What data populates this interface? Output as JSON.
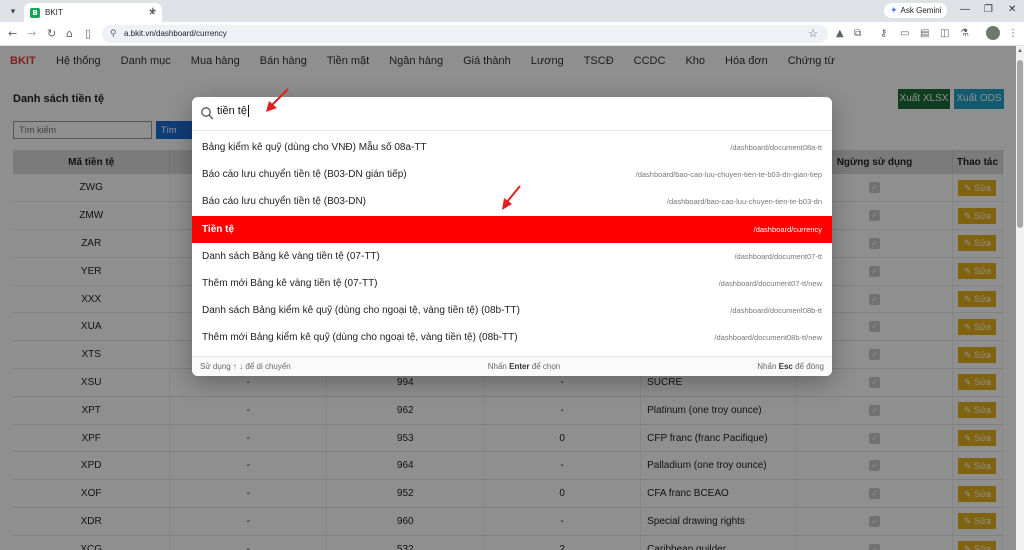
{
  "browser": {
    "tab_title": "BKIT",
    "favicon_letter": "B",
    "url": "a.bkit.vn/dashboard/currency",
    "ask_gemini": "Ask Gemini"
  },
  "app": {
    "brand": "BKIT",
    "nav": [
      "Hệ thống",
      "Danh mục",
      "Mua hàng",
      "Bán hàng",
      "Tiền mặt",
      "Ngân hàng",
      "Giá thành",
      "Lương",
      "TSCĐ",
      "CCDC",
      "Kho",
      "Hóa đơn",
      "Chứng từ"
    ],
    "page_title": "Danh sách tiền tệ",
    "export_xlsx": "Xuất XLSX",
    "export_ods": "Xuất ODS",
    "search_placeholder": "Tìm kiếm",
    "search_button": "Tìm",
    "columns": [
      "Mã tiền tệ",
      "",
      "",
      "",
      "",
      "Ngừng sử dụng",
      "Thao tác"
    ],
    "edit_label": "✎ Sửa",
    "rows": [
      {
        "code": "ZWG",
        "c2": "",
        "c3": "",
        "c4": "",
        "name": ""
      },
      {
        "code": "ZMW",
        "c2": "",
        "c3": "",
        "c4": "",
        "name": ""
      },
      {
        "code": "ZAR",
        "c2": "",
        "c3": "",
        "c4": "",
        "name": ""
      },
      {
        "code": "YER",
        "c2": "",
        "c3": "",
        "c4": "",
        "name": ""
      },
      {
        "code": "XXX",
        "c2": "",
        "c3": "",
        "c4": "",
        "name": ""
      },
      {
        "code": "XUA",
        "c2": "",
        "c3": "",
        "c4": "",
        "name": ""
      },
      {
        "code": "XTS",
        "c2": "",
        "c3": "",
        "c4": "",
        "name": ""
      },
      {
        "code": "XSU",
        "c2": "-",
        "c3": "994",
        "c4": "-",
        "name": "SUCRE"
      },
      {
        "code": "XPT",
        "c2": "-",
        "c3": "962",
        "c4": "-",
        "name": "Platinum (one troy ounce)"
      },
      {
        "code": "XPF",
        "c2": "-",
        "c3": "953",
        "c4": "0",
        "name": "CFP franc (franc Pacifique)"
      },
      {
        "code": "XPD",
        "c2": "-",
        "c3": "964",
        "c4": "-",
        "name": "Palladium (one troy ounce)"
      },
      {
        "code": "XOF",
        "c2": "-",
        "c3": "952",
        "c4": "0",
        "name": "CFA franc BCEAO"
      },
      {
        "code": "XDR",
        "c2": "-",
        "c3": "960",
        "c4": "-",
        "name": "Special drawing rights"
      },
      {
        "code": "XCG",
        "c2": "-",
        "c3": "532",
        "c4": "2",
        "name": "Caribbean guilder"
      }
    ]
  },
  "palette": {
    "query": "tiền tệ",
    "results": [
      {
        "title": "Bảng kiểm kê quỹ (dùng cho VNĐ) Mẫu số 08a-TT",
        "path": "/dashboard/document08a-tt"
      },
      {
        "title": "Báo cáo lưu chuyển tiền tệ (B03-DN gián tiếp)",
        "path": "/dashboard/bao-cao-luu-chuyen-tien-te-b03-dn-gian-tiep"
      },
      {
        "title": "Báo cáo lưu chuyển tiền tệ (B03-DN)",
        "path": "/dashboard/bao-cao-luu-chuyen-tien-te-b03-dn"
      },
      {
        "title": "Tiền tệ",
        "path": "/dashboard/currency"
      },
      {
        "title": "Danh sách Bảng kê vàng tiền tệ (07-TT)",
        "path": "/dashboard/document07-tt"
      },
      {
        "title": "Thêm mới Bảng kê vàng tiền tệ (07-TT)",
        "path": "/dashboard/document07-tt/new"
      },
      {
        "title": "Danh sách Bảng kiểm kê quỹ (dùng cho ngoại tệ, vàng tiền tệ) (08b-TT)",
        "path": "/dashboard/document08b-tt"
      },
      {
        "title": "Thêm mới Bảng kiểm kê quỹ (dùng cho ngoại tệ, vàng tiền tệ) (08b-TT)",
        "path": "/dashboard/document08b-tt/new"
      }
    ],
    "active_index": 3,
    "footer_move_prefix": "Sử dụng ↑ ↓ để di chuyển",
    "footer_enter_prefix": "Nhấn ",
    "footer_enter_key": "Enter",
    "footer_enter_suffix": " để chọn",
    "footer_esc_prefix": "Nhấn ",
    "footer_esc_key": "Esc",
    "footer_esc_suffix": " để đóng"
  },
  "colors": {
    "active_result": "#ff0000",
    "brand": "#e53935",
    "edit_button": "#e5b01c",
    "xlsx_button": "#1e6e3a",
    "ods_button": "#20a3c4",
    "annotation_arrow": "#e02020"
  }
}
